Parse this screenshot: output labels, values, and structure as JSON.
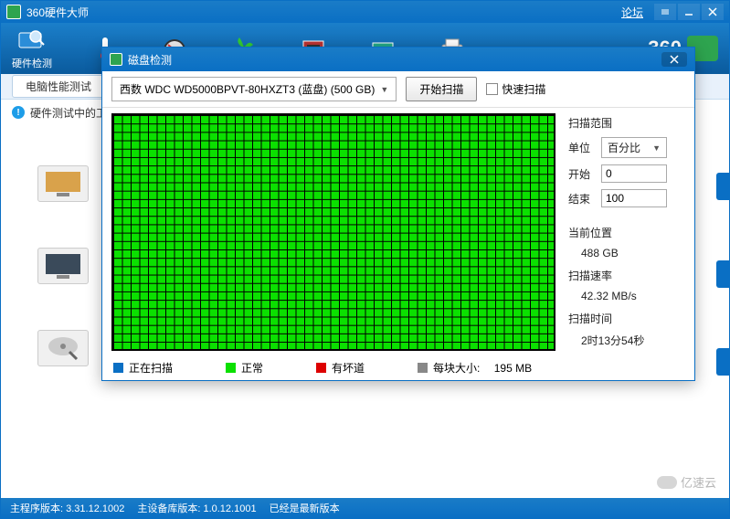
{
  "main": {
    "title": "360硬件大师",
    "forum": "论坛",
    "toolbar": {
      "item1": "硬件检测"
    },
    "brand": "360",
    "subbar": {
      "btn": "电脑性能测试"
    },
    "info": {
      "text": "硬件测试中的工"
    },
    "statusbar": {
      "s1": "主程序版本: 3.31.12.1002",
      "s2": "主设备库版本: 1.0.12.1001",
      "s3": "已经是最新版本"
    }
  },
  "dialog": {
    "title": "磁盘检测",
    "disk": "西数 WDC WD5000BPVT-80HXZT3 (蓝盘)  (500 GB)",
    "startScan": "开始扫描",
    "quickScan": "快速扫描",
    "range": {
      "title": "扫描范围",
      "unitLabel": "单位",
      "unitValue": "百分比",
      "startLabel": "开始",
      "startValue": "0",
      "endLabel": "结束",
      "endValue": "100"
    },
    "current": {
      "title": "当前位置",
      "value": "488 GB"
    },
    "speed": {
      "title": "扫描速率",
      "value": "42.32 MB/s"
    },
    "elapsed": {
      "title": "扫描时间",
      "value": "2时13分54秒"
    },
    "legend": {
      "scanning": "正在扫描",
      "normal": "正常",
      "bad": "有坏道",
      "blocksize": "每块大小:",
      "blocksizeValue": "195 MB"
    }
  },
  "watermark": "亿速云"
}
